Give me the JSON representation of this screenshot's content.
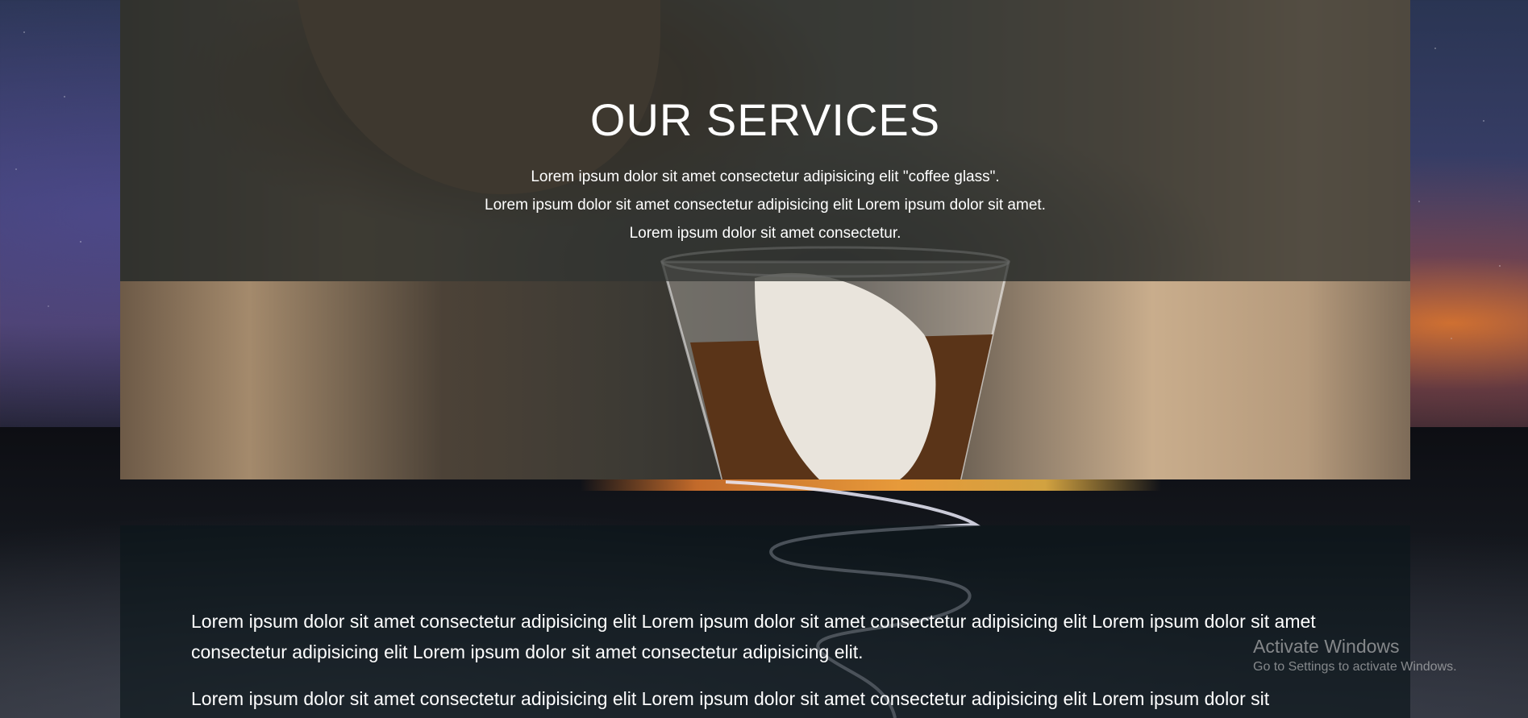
{
  "services": {
    "title": "OUR SERVICES",
    "description_lines": [
      "Lorem ipsum dolor sit amet consectetur adipisicing elit \"coffee glass\".",
      "Lorem ipsum dolor sit amet consectetur adipisicing elit Lorem ipsum dolor sit amet.",
      "Lorem ipsum dolor sit amet consectetur."
    ]
  },
  "panel": {
    "paragraphs": [
      "Lorem ipsum dolor sit amet consectetur adipisicing elit Lorem ipsum dolor sit amet consectetur adipisicing elit Lorem ipsum dolor sit amet consectetur adipisicing elit Lorem ipsum dolor sit amet consectetur adipisicing elit.",
      "Lorem ipsum dolor sit amet consectetur adipisicing elit Lorem ipsum dolor sit amet consectetur adipisicing elit Lorem ipsum dolor sit"
    ]
  },
  "watermark": {
    "title": "Activate Windows",
    "subtitle": "Go to Settings to activate Windows."
  }
}
